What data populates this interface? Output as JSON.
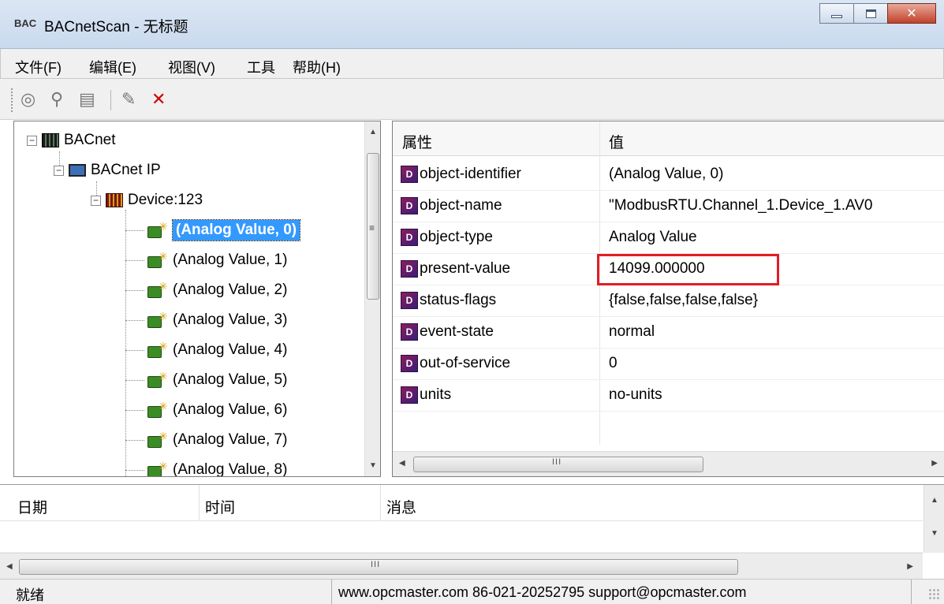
{
  "window": {
    "app_icon": "BAC",
    "title": "BACnetScan - 无标题"
  },
  "menu": [
    "文件(F)",
    "编辑(E)",
    "视图(V)",
    "工具",
    "帮助(H)"
  ],
  "toolbar": {
    "icons": [
      "discover-icon",
      "find-icon",
      "properties-icon",
      "write-icon",
      "delete-icon"
    ]
  },
  "tree": {
    "root": "BACnet",
    "network": "BACnet IP",
    "device": "Device:123",
    "objects": [
      "(Analog Value, 0)",
      "(Analog Value, 1)",
      "(Analog Value, 2)",
      "(Analog Value, 3)",
      "(Analog Value, 4)",
      "(Analog Value, 5)",
      "(Analog Value, 6)",
      "(Analog Value, 7)",
      "(Analog Value, 8)"
    ],
    "selected_index": 0
  },
  "properties": {
    "col_property": "属性",
    "col_value": "值",
    "rows": [
      {
        "name": "object-identifier",
        "value": "(Analog Value, 0)"
      },
      {
        "name": "object-name",
        "value": "\"ModbusRTU.Channel_1.Device_1.AV0"
      },
      {
        "name": "object-type",
        "value": "Analog Value"
      },
      {
        "name": "present-value",
        "value": "14099.000000"
      },
      {
        "name": "status-flags",
        "value": "{false,false,false,false}"
      },
      {
        "name": "event-state",
        "value": "normal"
      },
      {
        "name": "out-of-service",
        "value": "0"
      },
      {
        "name": "units",
        "value": "no-units"
      }
    ],
    "highlight_row": "present-value",
    "highlight_color": "#e31c23"
  },
  "log": {
    "col_date": "日期",
    "col_time": "时间",
    "col_message": "消息"
  },
  "status": {
    "left": "就绪",
    "right": "www.opcmaster.com 86-021-20252795 support@opcmaster.com"
  },
  "colors": {
    "selection": "#3399ff",
    "titlebar": "#c9d9ee",
    "close_button": "#c0412b"
  }
}
